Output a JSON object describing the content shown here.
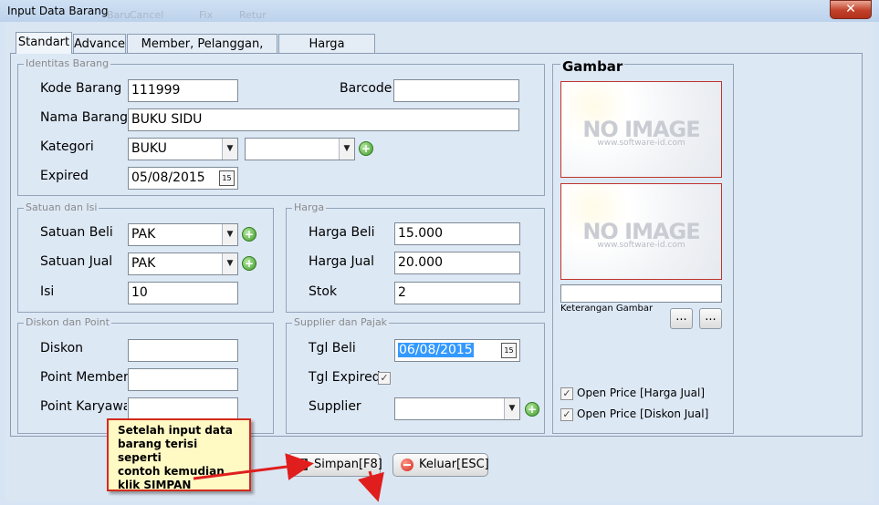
{
  "window": {
    "title": "Input Data Barang",
    "close_glyph": "✕",
    "ghost_toolbar": [
      "Baru",
      "Cancel",
      "Fix",
      "Retur"
    ]
  },
  "tabs": [
    "Standart",
    "Advance",
    "Member, Pelanggan, Sales",
    "Harga Bertingkat"
  ],
  "identitas": {
    "group_label": "Identitas Barang",
    "kode_label": "Kode Barang",
    "kode_value": "111999",
    "barcode_label": "Barcode",
    "barcode_value": "",
    "nama_label": "Nama Barang",
    "nama_value": "BUKU SIDU",
    "kategori_label": "Kategori",
    "kategori_value": "BUKU",
    "subkategori_value": "",
    "expired_label": "Expired",
    "expired_value": "05/08/2015"
  },
  "satuan": {
    "group_label": "Satuan dan Isi",
    "beli_label": "Satuan Beli",
    "beli_value": "PAK",
    "jual_label": "Satuan Jual",
    "jual_value": "PAK",
    "isi_label": "Isi",
    "isi_value": "10"
  },
  "harga": {
    "group_label": "Harga",
    "beli_label": "Harga Beli",
    "beli_value": "15.000",
    "jual_label": "Harga Jual",
    "jual_value": "20.000",
    "stok_label": "Stok",
    "stok_value": "2"
  },
  "diskon": {
    "group_label": "Diskon dan Point",
    "diskon_label": "Diskon",
    "diskon_value": "",
    "point_member_label": "Point Member",
    "point_member_value": "",
    "point_karyawan_label": "Point Karyawan",
    "point_karyawan_value": ""
  },
  "supplier": {
    "group_label": "Supplier dan Pajak",
    "tgl_beli_label": "Tgl Beli",
    "tgl_beli_value": "06/08/2015",
    "tgl_expired_label": "Tgl Expired",
    "tgl_expired_checked": true,
    "supplier_label": "Supplier",
    "supplier_value": ""
  },
  "gambar": {
    "title": "Gambar",
    "placeholder_text": "NO IMAGE",
    "placeholder_sub": "www.software-id.com",
    "keterangan_value": "",
    "keterangan_label": "Keterangan Gambar",
    "browse_label": "...",
    "open_price_jual": "Open Price [Harga Jual]",
    "open_price_diskon": "Open Price [Diskon Jual]"
  },
  "buttons": {
    "simpan": "Simpan[F8]",
    "keluar": "Keluar[ESC]"
  },
  "callout": {
    "text": "Setelah input data\nbarang terisi seperti\ncontoh kemudian\nklik SIMPAN"
  },
  "colors": {
    "callout_border": "#d22a1c",
    "callout_fill": "#fff9c4",
    "arrow": "#e01e1e",
    "plus_icon": "#3f9a2a"
  }
}
